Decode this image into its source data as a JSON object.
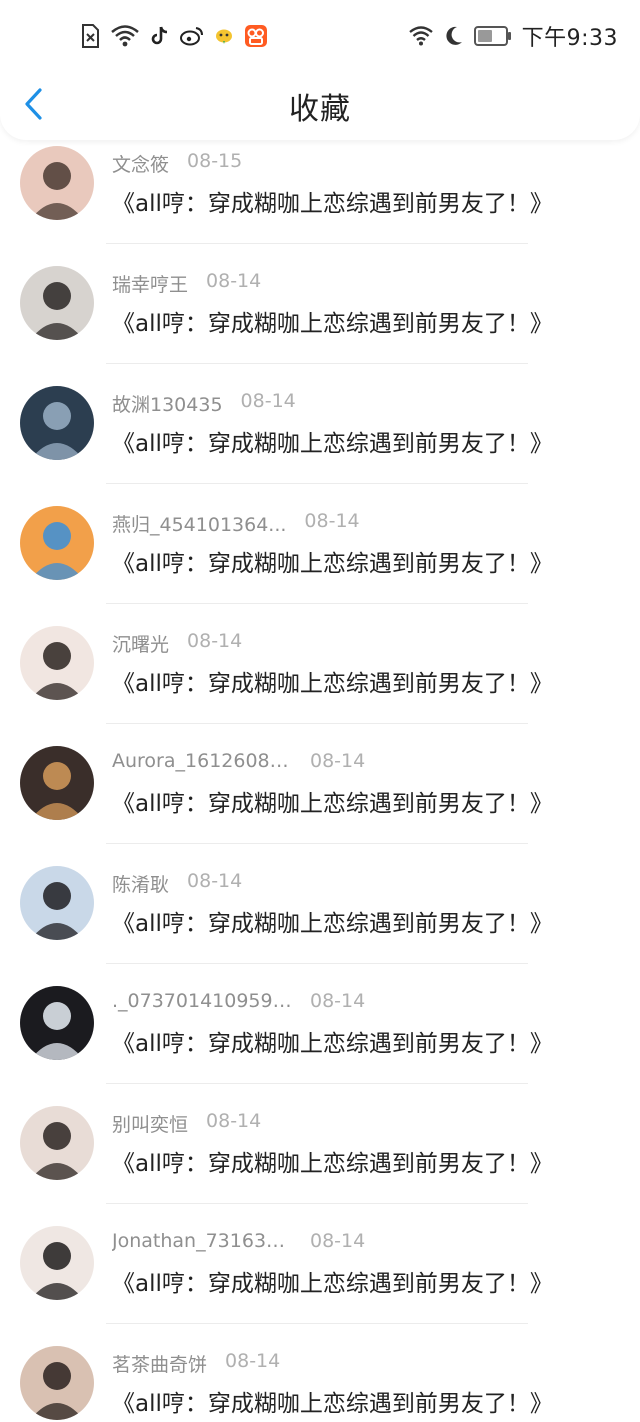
{
  "status_bar": {
    "time": "下午9:33",
    "left_icons": [
      "sim-off-icon",
      "wifi-icon",
      "tiktok-icon",
      "weibo-icon",
      "bird-app-icon",
      "kuaishou-icon"
    ],
    "right_icons": [
      "wifi-icon",
      "moon-icon",
      "battery-icon"
    ]
  },
  "header": {
    "title": "收藏",
    "back_icon": "chevron-left-icon"
  },
  "accent_color": "#1e90e6",
  "items": [
    {
      "name": "文念筱",
      "date": "08-15",
      "content": "《all哼：穿成糊咖上恋综遇到前男友了！》",
      "avatar_colors": [
        "#e9c9bd",
        "#4a3a33"
      ]
    },
    {
      "name": "瑞幸哼王",
      "date": "08-14",
      "content": "《all哼：穿成糊咖上恋综遇到前男友了！》",
      "avatar_colors": [
        "#d7d3cf",
        "#2a2624"
      ]
    },
    {
      "name": "故渊130435",
      "date": "08-14",
      "content": "《all哼：穿成糊咖上恋综遇到前男友了！》",
      "avatar_colors": [
        "#2c3e50",
        "#9ab0c6"
      ]
    },
    {
      "name": "燕归_454101364...",
      "date": "08-14",
      "content": "《all哼：穿成糊咖上恋综遇到前男友了！》",
      "avatar_colors": [
        "#f2a04a",
        "#3b8fd9"
      ]
    },
    {
      "name": "沉曙光",
      "date": "08-14",
      "content": "《all哼：穿成糊咖上恋综遇到前男友了！》",
      "avatar_colors": [
        "#f1e6e1",
        "#2b2320"
      ]
    },
    {
      "name": "Aurora_16126087...",
      "date": "08-14",
      "content": "《all哼：穿成糊咖上恋综遇到前男友了！》",
      "avatar_colors": [
        "#3a2e2a",
        "#d59a5a"
      ]
    },
    {
      "name": "陈淆耿",
      "date": "08-14",
      "content": "《all哼：穿成糊咖上恋综遇到前男友了！》",
      "avatar_colors": [
        "#c9d8e8",
        "#1e1e22"
      ]
    },
    {
      "name": "._0737014109597...",
      "date": "08-14",
      "content": "《all哼：穿成糊咖上恋综遇到前男友了！》",
      "avatar_colors": [
        "#1b1b1f",
        "#e8eef6"
      ]
    },
    {
      "name": "别叫奕恒",
      "date": "08-14",
      "content": "《all哼：穿成糊咖上恋综遇到前男友了！》",
      "avatar_colors": [
        "#e8dcd6",
        "#2c2522"
      ]
    },
    {
      "name": "Jonathan_731631...",
      "date": "08-14",
      "content": "《all哼：穿成糊咖上恋综遇到前男友了！》",
      "avatar_colors": [
        "#efe7e3",
        "#1f1c1c"
      ]
    },
    {
      "name": "茗茶曲奇饼",
      "date": "08-14",
      "content": "《all哼：穿成糊咖上恋综遇到前男友了！》",
      "avatar_colors": [
        "#d9c1b2",
        "#2a211e"
      ]
    }
  ]
}
